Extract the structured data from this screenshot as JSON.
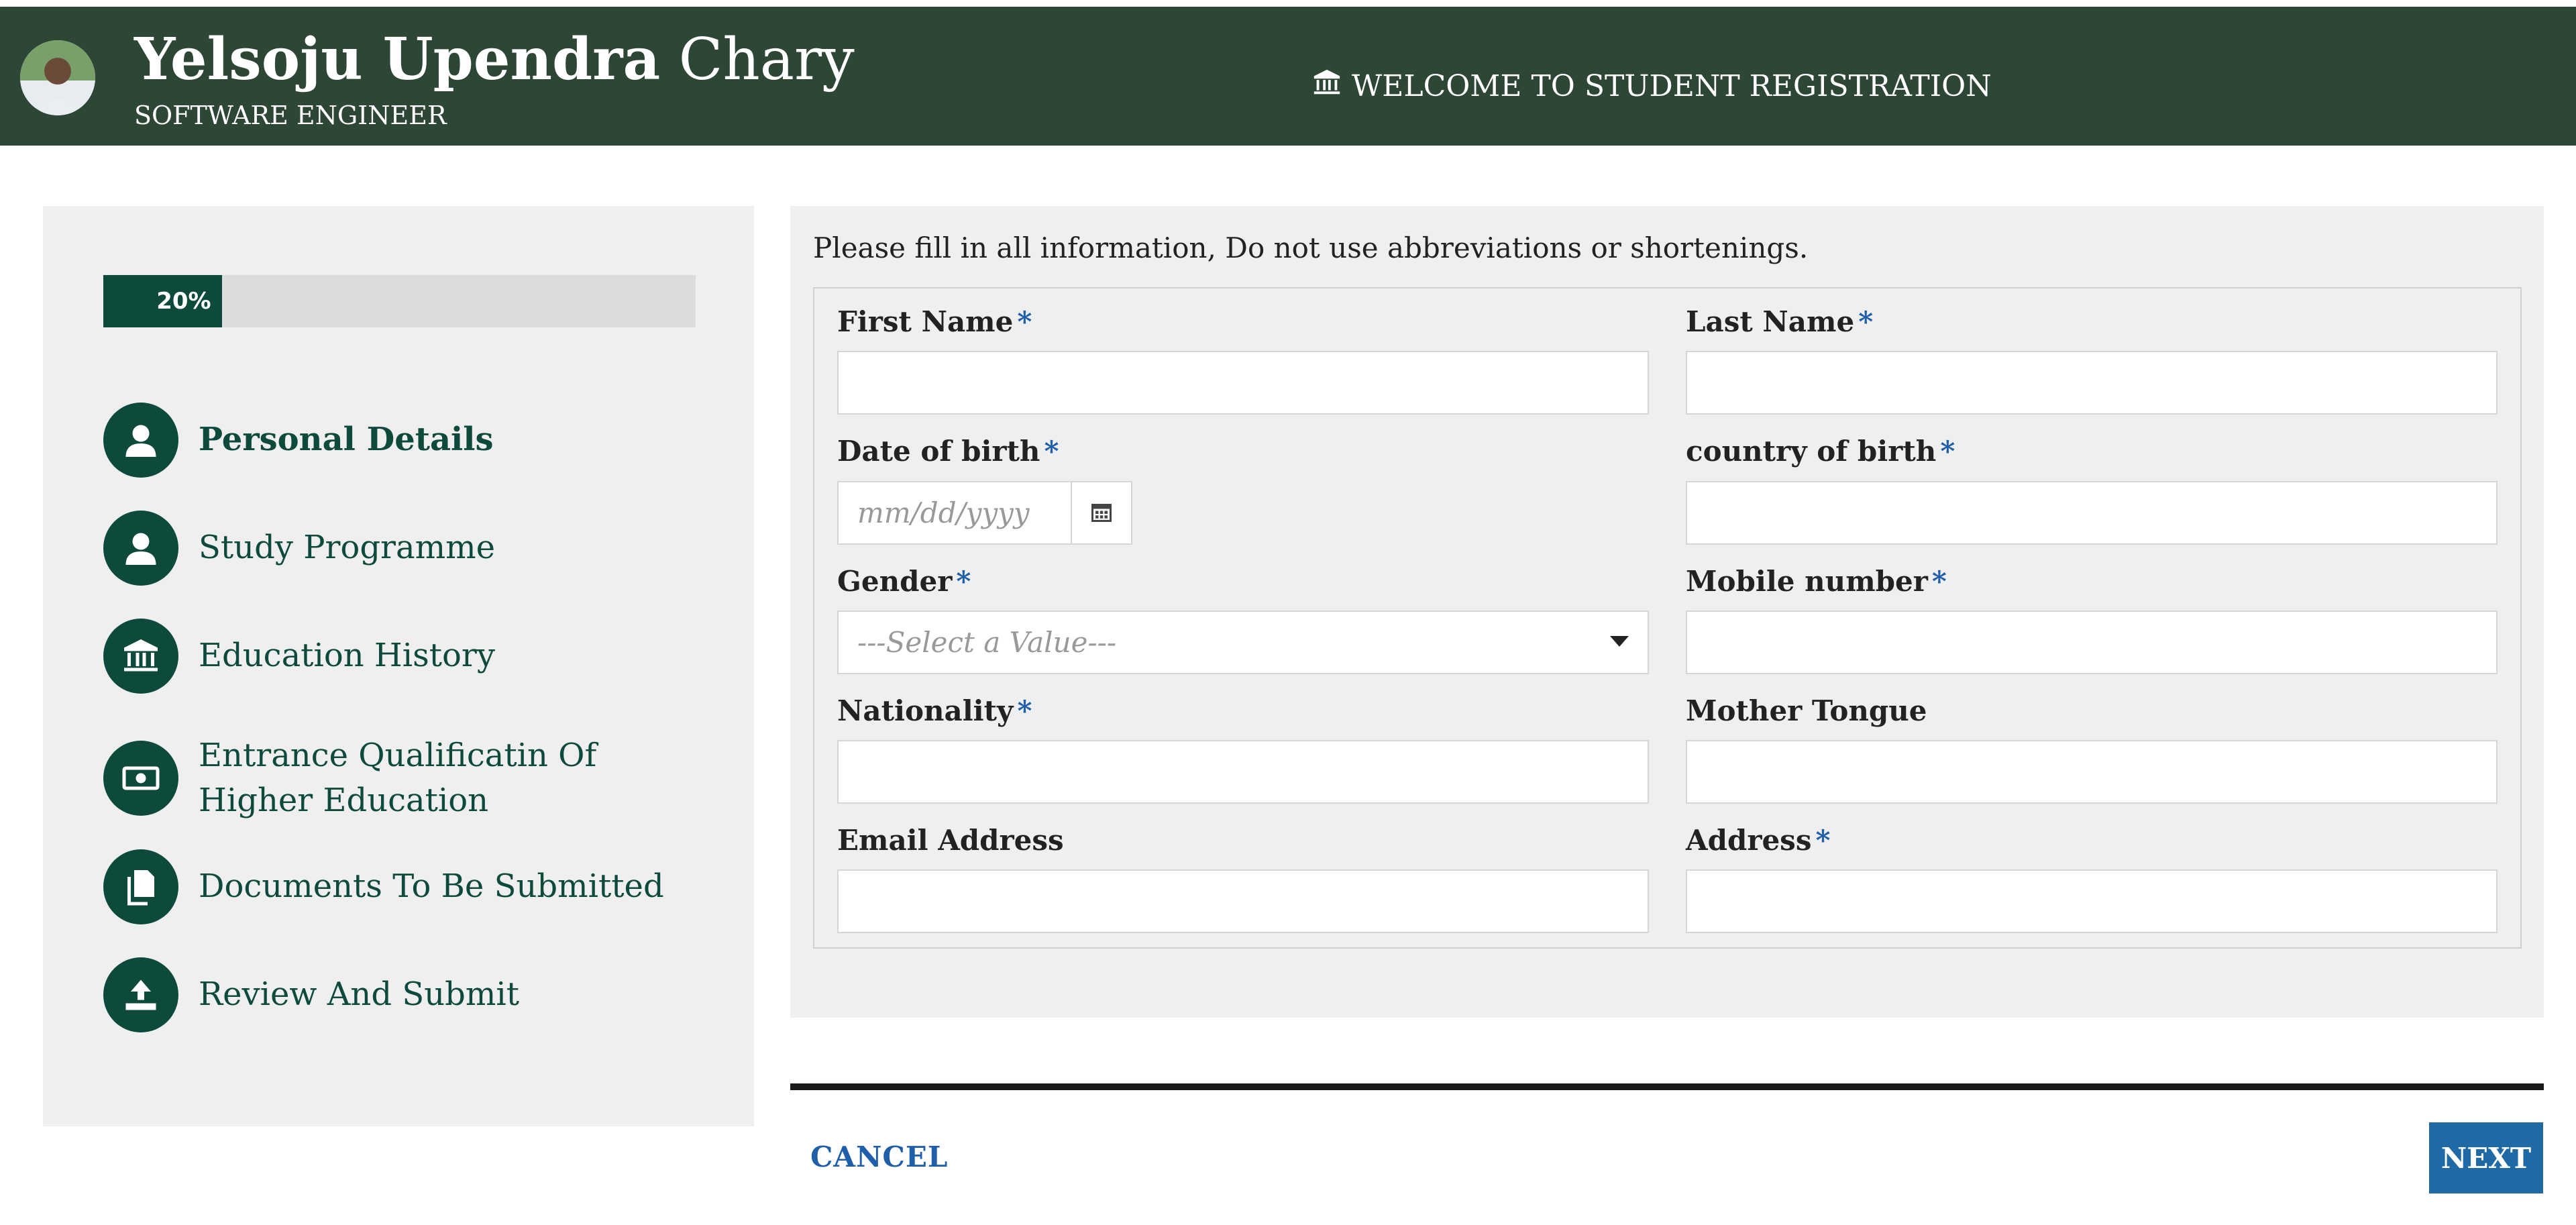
{
  "header": {
    "name_first": "Yelsoju Upendra",
    "name_last": "Chary",
    "role": "SOFTWARE ENGINEER",
    "welcome": "WELCOME TO STUDENT REGISTRATION",
    "welcome_icon": "institution-icon"
  },
  "progress": {
    "percent": 20,
    "label": "20%"
  },
  "steps": [
    {
      "label": "Personal Details",
      "icon": "user-icon",
      "active": true
    },
    {
      "label": "Study Programme",
      "icon": "user-icon",
      "active": false
    },
    {
      "label": "Education History",
      "icon": "institution-icon",
      "active": false
    },
    {
      "label": "Entrance Qualificatin Of Higher Education",
      "icon": "money-icon",
      "active": false
    },
    {
      "label": "Documents To Be Submitted",
      "icon": "documents-icon",
      "active": false
    },
    {
      "label": "Review And Submit",
      "icon": "upload-icon",
      "active": false
    }
  ],
  "form": {
    "note": "Please fill in all information, Do not use abbreviations or shortenings.",
    "required_mark": "*",
    "first_name": {
      "label": "First Name",
      "value": ""
    },
    "last_name": {
      "label": "Last Name",
      "value": ""
    },
    "dob": {
      "label": "Date of birth",
      "placeholder": "mm/dd/yyyy"
    },
    "country_of_birth": {
      "label": "country of birth",
      "value": ""
    },
    "gender": {
      "label": "Gender",
      "selected": "---Select a Value---"
    },
    "mobile": {
      "label": "Mobile number",
      "value": ""
    },
    "nationality": {
      "label": "Nationality",
      "value": ""
    },
    "mother_tongue": {
      "label": "Mother Tongue",
      "value": ""
    },
    "email": {
      "label": "Email Address",
      "value": ""
    },
    "address": {
      "label": "Address",
      "value": ""
    }
  },
  "actions": {
    "cancel": "CANCEL",
    "next": "NEXT"
  },
  "colors": {
    "header_bg": "#2e4636",
    "accent": "#0e4a3c",
    "link": "#1f5ea8",
    "next_bg": "#1f6aa5",
    "panel_bg": "#efefef"
  }
}
